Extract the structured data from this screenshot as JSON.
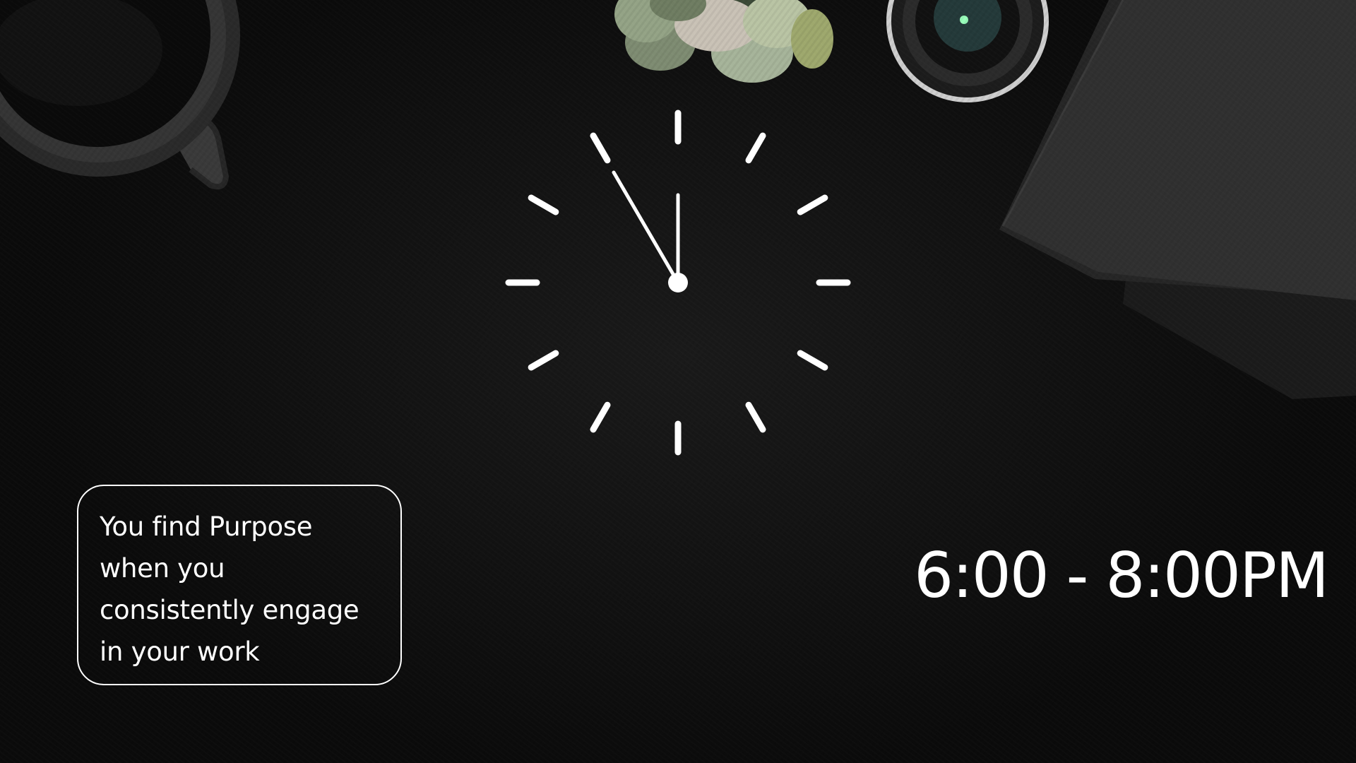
{
  "background": {
    "surface": "dark leather desk",
    "base_color": "#121212",
    "objects": [
      "coffee-mug",
      "succulent-plant",
      "camera-lens",
      "notebooks"
    ]
  },
  "clock": {
    "color": "#ffffff",
    "time_shown": "11:55",
    "tick_marks": 12
  },
  "quote": {
    "text_line_1": "You find Purpose",
    "text_line_2": "when you",
    "text_line_3": "consistently engage",
    "text_line_4": "in your work",
    "border_color": "#ffffff"
  },
  "schedule": {
    "time_range": "6:00 - 8:00PM",
    "text_color": "#ffffff"
  }
}
